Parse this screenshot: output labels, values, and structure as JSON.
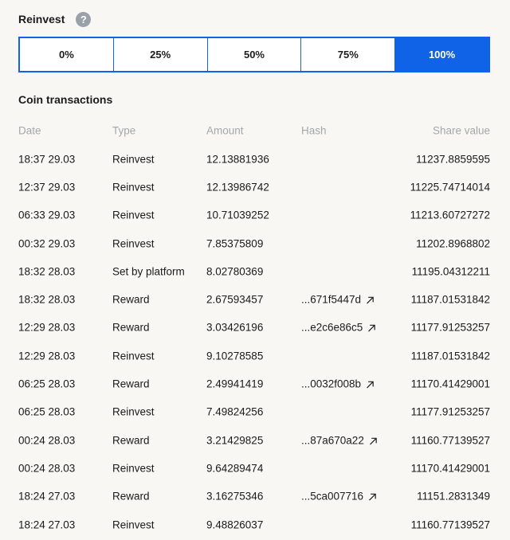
{
  "reinvest": {
    "title": "Reinvest",
    "help_label": "?",
    "options": [
      {
        "label": "0%",
        "active": false
      },
      {
        "label": "25%",
        "active": false
      },
      {
        "label": "50%",
        "active": false
      },
      {
        "label": "75%",
        "active": false
      },
      {
        "label": "100%",
        "active": true
      }
    ]
  },
  "transactions": {
    "title": "Coin transactions",
    "columns": {
      "date": "Date",
      "type": "Type",
      "amount": "Amount",
      "hash": "Hash",
      "share": "Share value"
    },
    "rows": [
      {
        "date": "18:37 29.03",
        "type": "Reinvest",
        "amount": "12.13881936",
        "hash": "",
        "share": "11237.8859595"
      },
      {
        "date": "12:37 29.03",
        "type": "Reinvest",
        "amount": "12.13986742",
        "hash": "",
        "share": "11225.74714014"
      },
      {
        "date": "06:33 29.03",
        "type": "Reinvest",
        "amount": "10.71039252",
        "hash": "",
        "share": "11213.60727272"
      },
      {
        "date": "00:32 29.03",
        "type": "Reinvest",
        "amount": "7.85375809",
        "hash": "",
        "share": "11202.8968802"
      },
      {
        "date": "18:32 28.03",
        "type": "Set by platform",
        "amount": "8.02780369",
        "hash": "",
        "share": "11195.04312211"
      },
      {
        "date": "18:32 28.03",
        "type": "Reward",
        "amount": "2.67593457",
        "hash": "...671f5447d",
        "share": "11187.01531842"
      },
      {
        "date": "12:29 28.03",
        "type": "Reward",
        "amount": "3.03426196",
        "hash": "...e2c6e86c5",
        "share": "11177.91253257"
      },
      {
        "date": "12:29 28.03",
        "type": "Reinvest",
        "amount": "9.10278585",
        "hash": "",
        "share": "11187.01531842"
      },
      {
        "date": "06:25 28.03",
        "type": "Reward",
        "amount": "2.49941419",
        "hash": "...0032f008b",
        "share": "11170.41429001"
      },
      {
        "date": "06:25 28.03",
        "type": "Reinvest",
        "amount": "7.49824256",
        "hash": "",
        "share": "11177.91253257"
      },
      {
        "date": "00:24 28.03",
        "type": "Reward",
        "amount": "3.21429825",
        "hash": "...87a670a22",
        "share": "11160.77139527"
      },
      {
        "date": "00:24 28.03",
        "type": "Reinvest",
        "amount": "9.64289474",
        "hash": "",
        "share": "11170.41429001"
      },
      {
        "date": "18:24 27.03",
        "type": "Reward",
        "amount": "3.16275346",
        "hash": "...5ca007716",
        "share": "11151.2831349"
      },
      {
        "date": "18:24 27.03",
        "type": "Reinvest",
        "amount": "9.48826037",
        "hash": "",
        "share": "11160.77139527"
      }
    ]
  },
  "colors": {
    "accent": "#1062e6",
    "muted": "#a3a7ad",
    "background": "#f8f7f4"
  },
  "icons": {
    "help": "question-circle-icon",
    "external_link": "arrow-up-right-icon"
  }
}
